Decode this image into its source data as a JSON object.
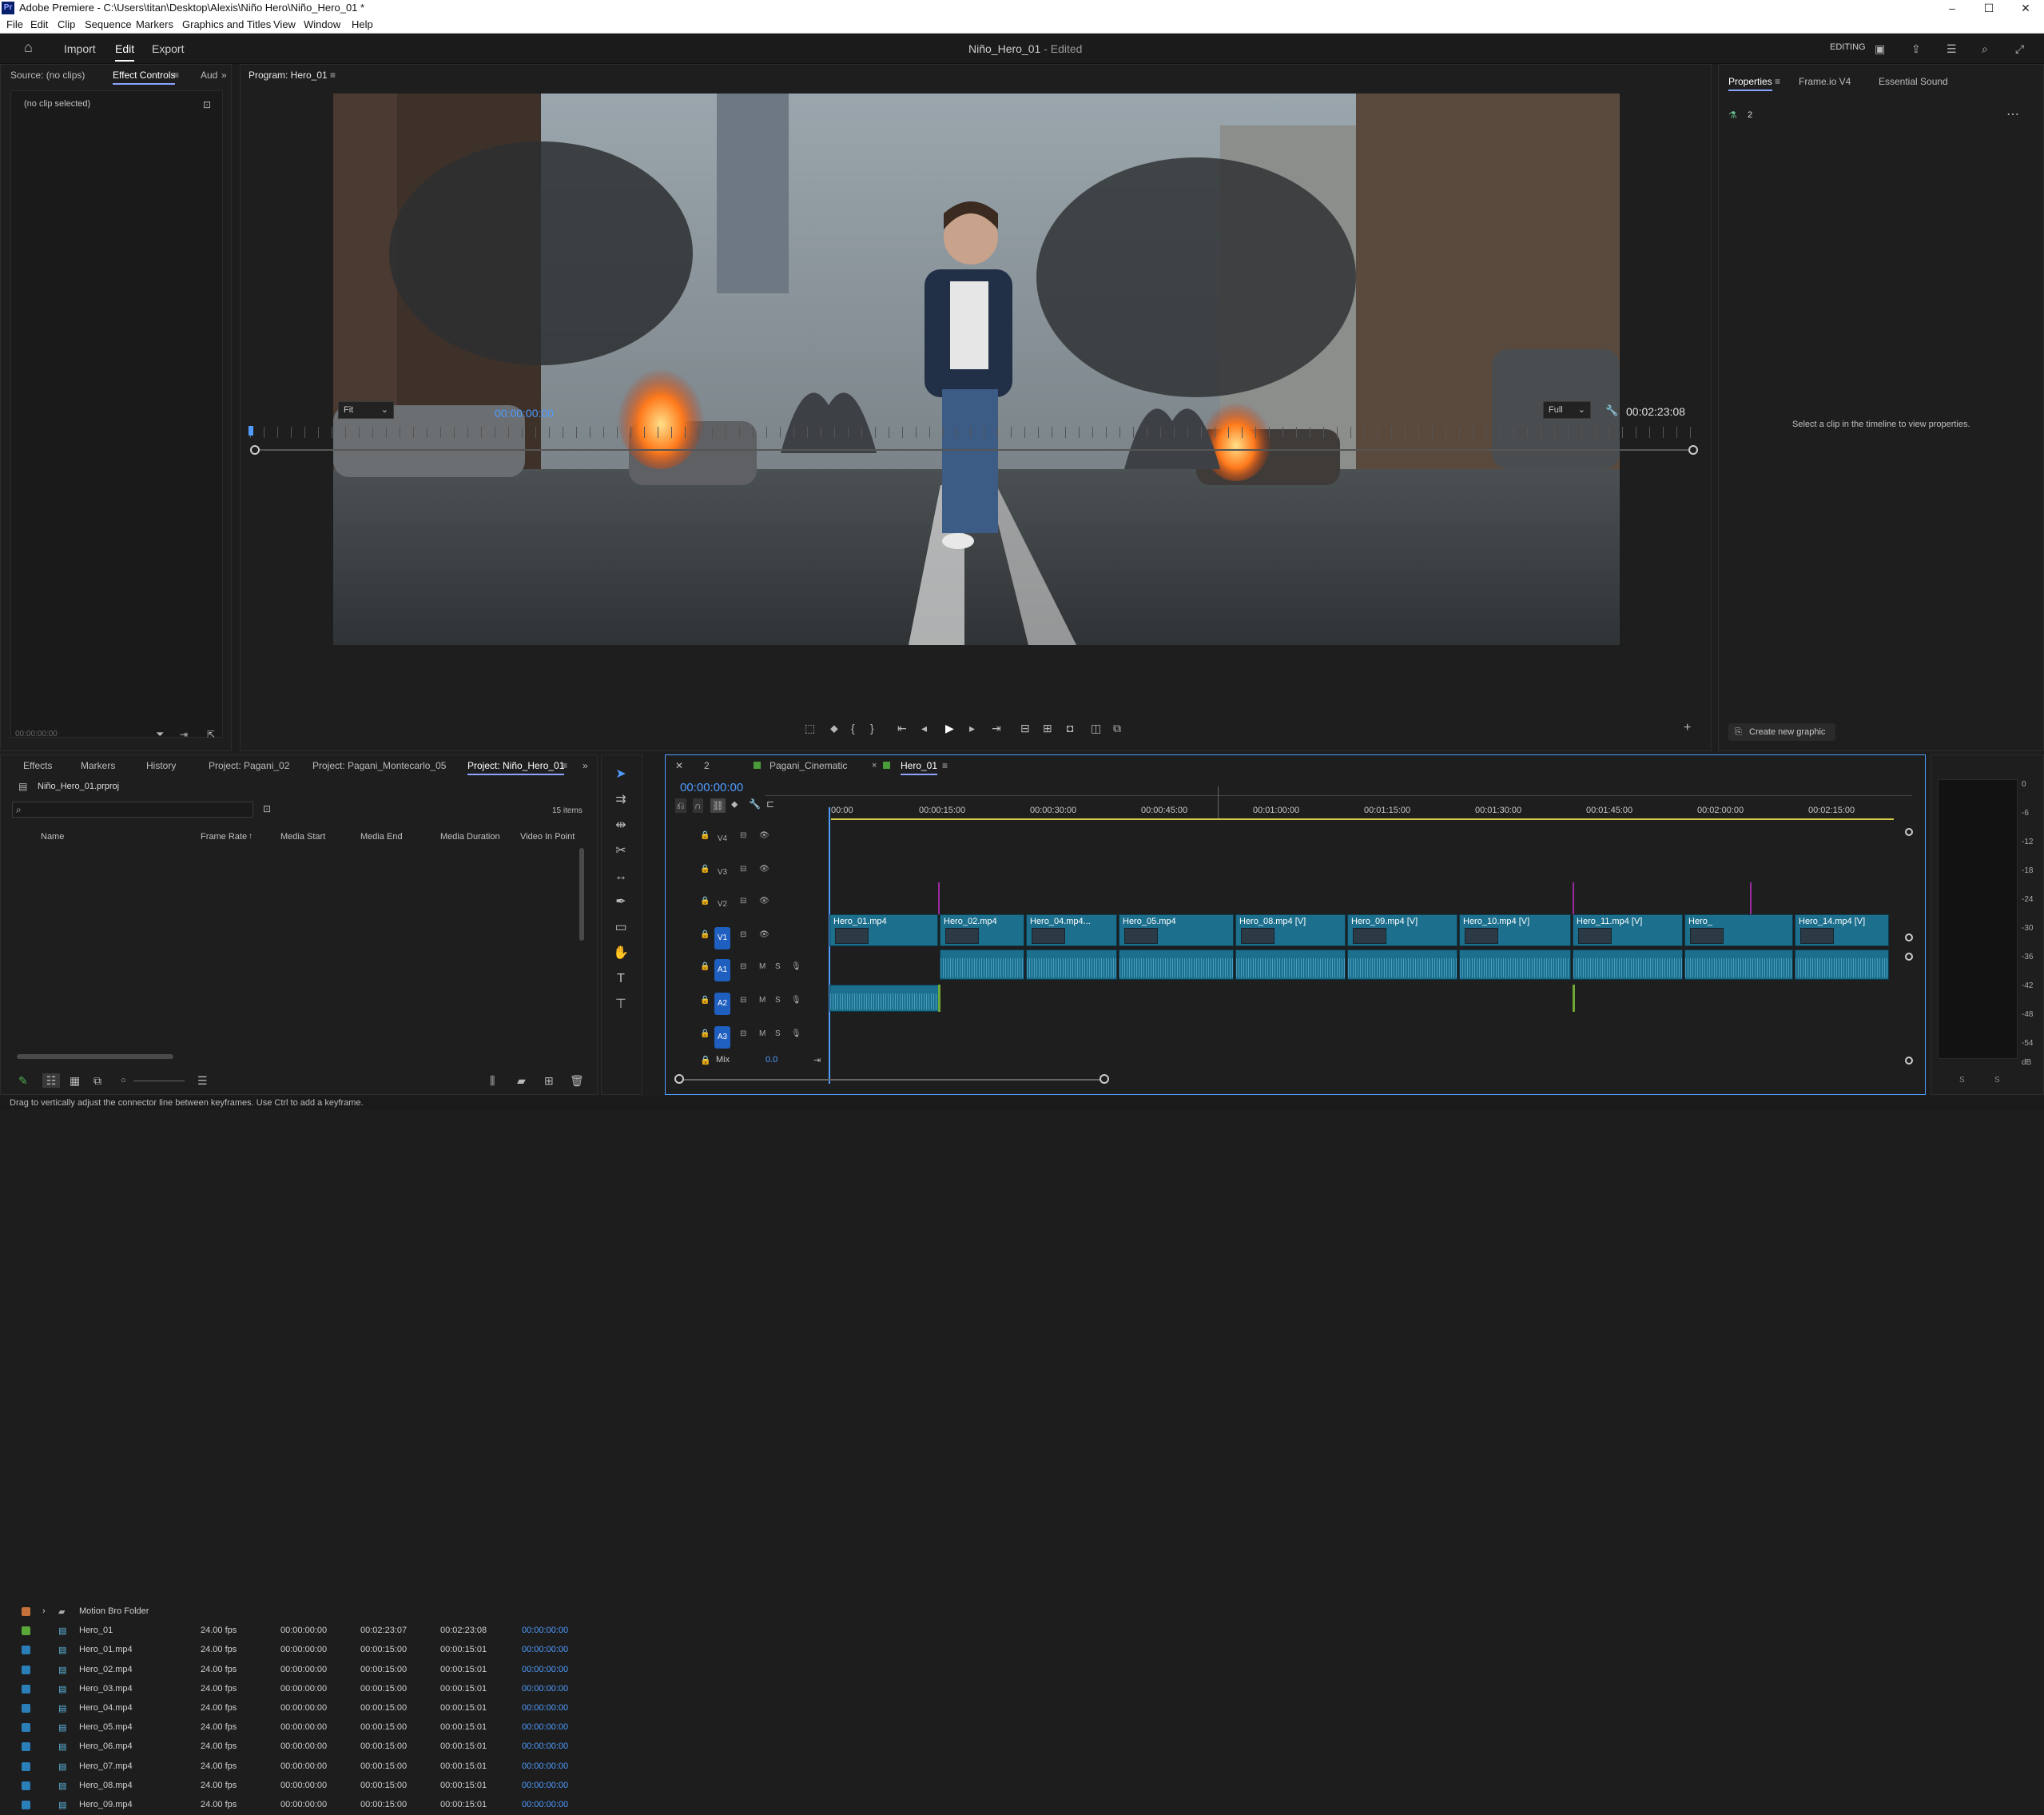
{
  "window": {
    "app_icon": "Pr",
    "title": "Adobe Premiere - C:\\Users\\titan\\Desktop\\Alexis\\Niño Hero\\Niño_Hero_01 *",
    "minimize": "–",
    "maximize": "☐",
    "close": "✕"
  },
  "menu": [
    "File",
    "Edit",
    "Clip",
    "Sequence",
    "Markers",
    "Graphics and Titles",
    "View",
    "Window",
    "Help"
  ],
  "header": {
    "tabs": [
      "Import",
      "Edit",
      "Export"
    ],
    "active_tab": "Edit",
    "project_title": "Niño_Hero_01",
    "status": " - Edited",
    "workspace": "EDITING"
  },
  "source_panel": {
    "tabs": [
      "Source: (no clips)",
      "Effect Controls",
      "Aud"
    ],
    "empty_message": "(no clip selected)",
    "timecode": "00:00:00:00"
  },
  "program_monitor": {
    "tab": "Program: Hero_01",
    "timecode_current": "00:00:00:00",
    "zoom": "Fit",
    "resolution": "Full",
    "timecode_duration": "00:02:23:08"
  },
  "properties_panel": {
    "tabs": [
      "Properties",
      "Frame.io V4",
      "Essential Sound"
    ],
    "item_count": "2",
    "empty_message": "Select a clip in the timeline to view properties.",
    "create_graphic": "Create new graphic"
  },
  "project_panel": {
    "tabs": [
      "Effects",
      "Markers",
      "History",
      "Project: Pagani_02",
      "Project: Pagani_Montecarlo_05",
      "Project: Niño_Hero_01"
    ],
    "file": "Niño_Hero_01.prproj",
    "items_count": "15 items",
    "columns": [
      "Name",
      "Frame Rate",
      "Media Start",
      "Media End",
      "Media Duration",
      "Video In Point"
    ],
    "rows": [
      {
        "name": "Motion Bro Folder",
        "color": "#c6713a",
        "fps": "",
        "start": "",
        "end": "",
        "dur": "",
        "in": ""
      },
      {
        "name": "Hero_01",
        "color": "#5aa83a",
        "fps": "24.00 fps",
        "start": "00:00:00:00",
        "end": "00:02:23:07",
        "dur": "00:02:23:08",
        "in": "00:00:00:00"
      },
      {
        "name": "Hero_01.mp4",
        "color": "#2b7fb8",
        "fps": "24.00 fps",
        "start": "00:00:00:00",
        "end": "00:00:15:00",
        "dur": "00:00:15:01",
        "in": "00:00:00:00"
      },
      {
        "name": "Hero_02.mp4",
        "color": "#2b7fb8",
        "fps": "24.00 fps",
        "start": "00:00:00:00",
        "end": "00:00:15:00",
        "dur": "00:00:15:01",
        "in": "00:00:00:00"
      },
      {
        "name": "Hero_03.mp4",
        "color": "#2b7fb8",
        "fps": "24.00 fps",
        "start": "00:00:00:00",
        "end": "00:00:15:00",
        "dur": "00:00:15:01",
        "in": "00:00:00:00"
      },
      {
        "name": "Hero_04.mp4",
        "color": "#2b7fb8",
        "fps": "24.00 fps",
        "start": "00:00:00:00",
        "end": "00:00:15:00",
        "dur": "00:00:15:01",
        "in": "00:00:00:00"
      },
      {
        "name": "Hero_05.mp4",
        "color": "#2b7fb8",
        "fps": "24.00 fps",
        "start": "00:00:00:00",
        "end": "00:00:15:00",
        "dur": "00:00:15:01",
        "in": "00:00:00:00"
      },
      {
        "name": "Hero_06.mp4",
        "color": "#2b7fb8",
        "fps": "24.00 fps",
        "start": "00:00:00:00",
        "end": "00:00:15:00",
        "dur": "00:00:15:01",
        "in": "00:00:00:00"
      },
      {
        "name": "Hero_07.mp4",
        "color": "#2b7fb8",
        "fps": "24.00 fps",
        "start": "00:00:00:00",
        "end": "00:00:15:00",
        "dur": "00:00:15:01",
        "in": "00:00:00:00"
      },
      {
        "name": "Hero_08.mp4",
        "color": "#2b7fb8",
        "fps": "24.00 fps",
        "start": "00:00:00:00",
        "end": "00:00:15:00",
        "dur": "00:00:15:01",
        "in": "00:00:00:00"
      },
      {
        "name": "Hero_09.mp4",
        "color": "#2b7fb8",
        "fps": "24.00 fps",
        "start": "00:00:00:00",
        "end": "00:00:15:00",
        "dur": "00:00:15:01",
        "in": "00:00:00:00"
      }
    ]
  },
  "timeline": {
    "tabs": [
      "2",
      "Pagani_Cinematic",
      "Hero_01"
    ],
    "timecode": "00:00:00:00",
    "ruler": [
      ":00:00",
      "00:00:15:00",
      "00:00:30:00",
      "00:00:45:00",
      "00:01:00:00",
      "00:01:15:00",
      "00:01:30:00",
      "00:01:45:00",
      "00:02:00:00",
      "00:02:15:00"
    ],
    "tracks": [
      "V4",
      "V3",
      "V2",
      "V1",
      "A1",
      "A2",
      "A3"
    ],
    "mix_label": "Mix",
    "mix_value": "0.0",
    "video_clips": [
      "Hero_01.mp4",
      "Hero_02.mp4",
      "Hero_04.mp4...",
      "Hero_05.mp4",
      "Hero_08.mp4 [V]",
      "Hero_09.mp4 [V]",
      "Hero_10.mp4 [V]",
      "Hero_11.mp4 [V]",
      "Hero_",
      "Hero_14.mp4 [V]"
    ]
  },
  "meters": {
    "labels": [
      "0",
      "-6",
      "-12",
      "-18",
      "-24",
      "-30",
      "-36",
      "-42",
      "-48",
      "-54",
      "dB"
    ],
    "solo": [
      "S",
      "S"
    ]
  },
  "status": "Drag to vertically adjust the connector line between keyframes. Use Ctrl to add a keyframe."
}
